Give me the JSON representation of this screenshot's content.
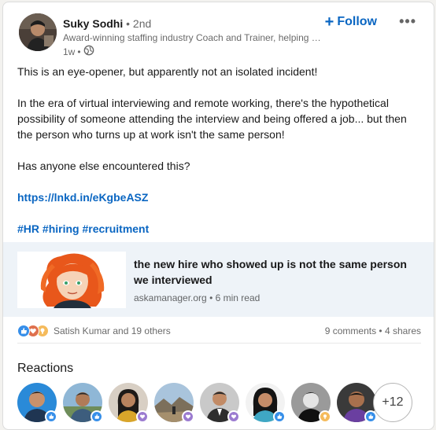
{
  "post": {
    "author": {
      "name": "Suky Sodhi",
      "degree": "2nd",
      "headline": "Award-winning staffing industry Coach and Trainer, helping staffing businesses grow",
      "time": "1w",
      "dot": "•",
      "visibility_icon": "globe-icon"
    },
    "follow_label": "Follow",
    "more_label": "•••",
    "text": {
      "p1": "This is an eye-opener, but apparently not an isolated incident!",
      "p2": "In the era of virtual interviewing and remote working, there's the hypothetical possibility of someone attending the interview and being offered a job... but then the person who turns up at work isn't the same person!",
      "p3": "Has anyone else encountered this?",
      "link": "https://lnkd.in/eKgbeASZ",
      "hashtags": [
        "#HR",
        "#hiring",
        "#recruitment"
      ]
    },
    "article": {
      "title": "the new hire who showed up is not the same person we interviewed",
      "source": "askamanager.org",
      "read_time": "6 min read",
      "dot": "•"
    },
    "social": {
      "reaction_icons": [
        "like-icon",
        "love-icon",
        "insightful-icon"
      ],
      "reactors_summary": "Satish Kumar and 19 others",
      "comments": "9 comments",
      "shares": "4 shares",
      "dot": "•"
    },
    "reactions": {
      "title": "Reactions",
      "people_badges": [
        "like",
        "like",
        "love",
        "love",
        "love",
        "like",
        "insightful",
        "like"
      ],
      "more_count": "+12"
    }
  },
  "colors": {
    "accent": "#0a66c2",
    "like": "#378fe9",
    "love": "#df704d",
    "insightful": "#f5bb5c",
    "support": "#9b7bd0",
    "article_bg": "#eef3f8"
  }
}
